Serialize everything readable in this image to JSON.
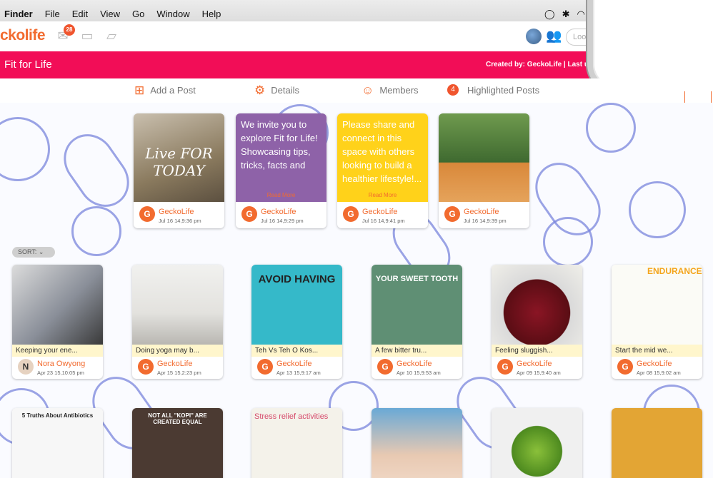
{
  "menubar": {
    "items": [
      "Finder",
      "File",
      "Edit",
      "View",
      "Go",
      "Window",
      "Help"
    ]
  },
  "app": {
    "logo_text": "ckolife",
    "notif_count": "28",
    "lookup_placeholder": "Look"
  },
  "group": {
    "title": "Fit for Life",
    "created_by": "Created by: GeckoLife | Last updated:"
  },
  "nav": {
    "add_post": "Add a Post",
    "details": "Details",
    "members": "Members",
    "highlighted": "Highlighted Posts",
    "highlighted_count": "4"
  },
  "sort_label": "SORT:",
  "highlighted_posts": [
    {
      "kind": "image",
      "image_text": "Live FOR TODAY",
      "author": "GeckoLife",
      "date": "Jul 16 14,9:36 pm"
    },
    {
      "kind": "text",
      "text": "We invite you to explore Fit for Life! Showcasing tips, tricks, facts and",
      "read_more": "Read More",
      "author": "GeckoLife",
      "date": "Jul 16 14,9:29 pm",
      "color": "#8e62a8"
    },
    {
      "kind": "text",
      "text": "Please share and connect in this space with others looking to build a healthier lifestyle!...",
      "read_more": "Read More",
      "author": "GeckoLife",
      "date": "Jul 16 14,9:41 pm",
      "color": "#ffd21a"
    },
    {
      "kind": "image",
      "image_text": "",
      "author": "GeckoLife",
      "date": "Jul 16 14,9:39 pm"
    }
  ],
  "posts_row1": [
    {
      "caption": "Keeping your ene...",
      "author": "Nora Owyong",
      "date": "Apr 23 15,10:05 pm"
    },
    {
      "caption": "Doing yoga may b...",
      "author": "GeckoLife",
      "date": "Apr 15 15,2:23 pm"
    },
    {
      "caption": "Teh Vs Teh O Kos...",
      "author": "GeckoLife",
      "date": "Apr 13 15,9:17 am",
      "image_title": "AVOID HAVING"
    },
    {
      "caption": "A few bitter tru...",
      "author": "GeckoLife",
      "date": "Apr 10 15,9:53 am",
      "image_title": "YOUR SWEET TOOTH"
    },
    {
      "caption": "Feeling sluggish...",
      "author": "GeckoLife",
      "date": "Apr 09 15,9:40 am"
    },
    {
      "caption": "Start the mid we...",
      "author": "GeckoLife",
      "date": "Apr 08 15,9:02 am",
      "image_title": "ENDURANCE"
    }
  ],
  "posts_row2": [
    {
      "image_title": "5 Truths About Antibiotics"
    },
    {
      "image_title": "NOT ALL \"KOPI\" ARE CREATED EQUAL"
    },
    {
      "image_title": "Stress relief activities"
    },
    {
      "image_title": ""
    },
    {
      "image_title": ""
    },
    {
      "image_title": ""
    }
  ]
}
